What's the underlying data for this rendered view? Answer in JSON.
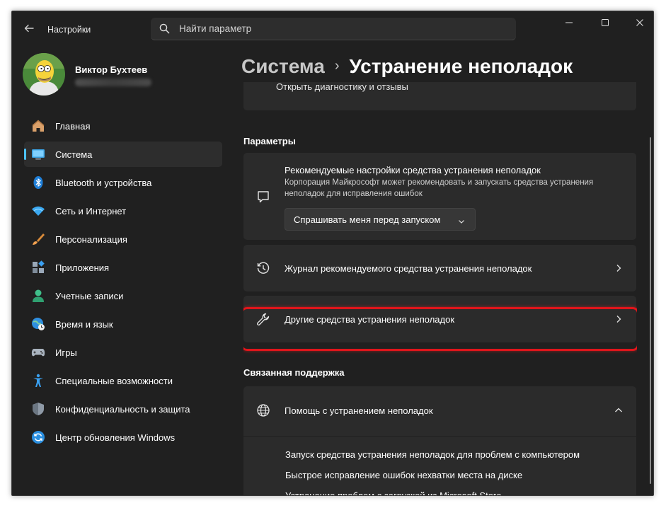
{
  "window": {
    "app_title": "Настройки",
    "search_placeholder": "Найти параметр",
    "controls": {
      "minimize": "—",
      "maximize": "☐",
      "close": "✕"
    }
  },
  "profile": {
    "name": "Виктор Бухтеев"
  },
  "sidebar": {
    "items": [
      {
        "label": "Главная",
        "icon": "home-icon"
      },
      {
        "label": "Система",
        "icon": "system-icon",
        "active": true
      },
      {
        "label": "Bluetooth и устройства",
        "icon": "bluetooth-icon"
      },
      {
        "label": "Сеть и Интернет",
        "icon": "wifi-icon"
      },
      {
        "label": "Персонализация",
        "icon": "brush-icon"
      },
      {
        "label": "Приложения",
        "icon": "apps-icon"
      },
      {
        "label": "Учетные записи",
        "icon": "person-icon"
      },
      {
        "label": "Время и язык",
        "icon": "globe-clock-icon"
      },
      {
        "label": "Игры",
        "icon": "gamepad-icon"
      },
      {
        "label": "Специальные возможности",
        "icon": "accessibility-icon"
      },
      {
        "label": "Конфиденциальность и защита",
        "icon": "shield-icon"
      },
      {
        "label": "Центр обновления Windows",
        "icon": "update-icon"
      }
    ]
  },
  "breadcrumb": {
    "parent": "Система",
    "separator": "›",
    "current": "Устранение неполадок"
  },
  "main": {
    "partial_card_text": "Открыть диагностику и отзывы",
    "params_title": "Параметры",
    "recommended": {
      "title": "Рекомендуемые настройки средства устранения неполадок",
      "desc_line1": "Корпорация Майкрософт может рекомендовать и запускать средства устранения",
      "desc_line2": "неполадок для исправления ошибок",
      "dropdown_value": "Спрашивать меня перед запуском"
    },
    "history_label": "Журнал рекомендуемого средства устранения неполадок",
    "other_label": "Другие средства устранения неполадок",
    "related_title": "Связанная поддержка",
    "help": {
      "title": "Помощь с устранением неполадок",
      "links": [
        "Запуск средства устранения неполадок для проблем с компьютером",
        "Быстрое исправление ошибок нехватки места на диске",
        "Устранение проблем с загрузкой из Microsoft Store"
      ]
    }
  },
  "colors": {
    "accent": "#4cc2ff",
    "highlight": "#e0151b",
    "background": "#202020",
    "card": "#2b2b2b"
  }
}
